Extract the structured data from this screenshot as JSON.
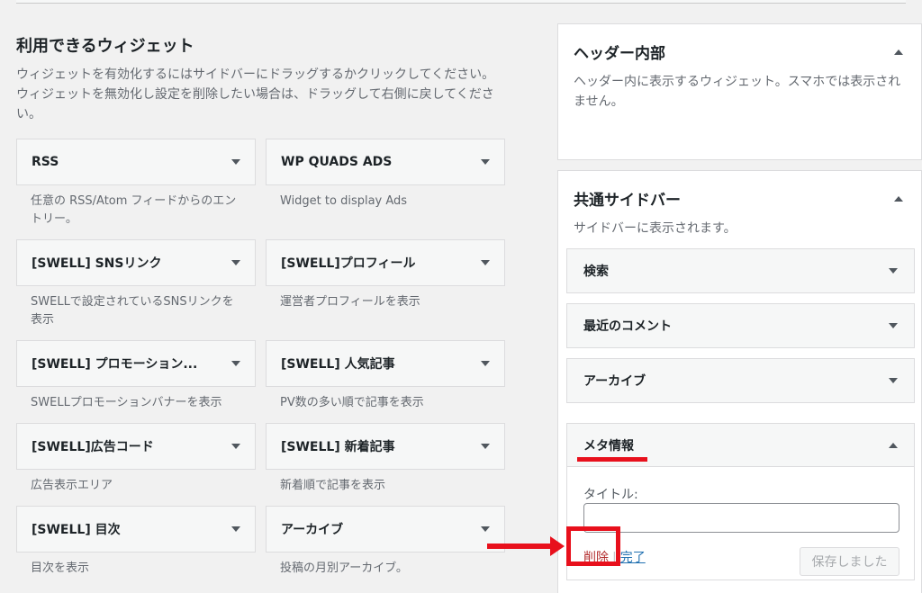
{
  "available": {
    "title": "利用できるウィジェット",
    "description": "ウィジェットを有効化するにはサイドバーにドラッグするかクリックしてください。ウィジェットを無効化し設定を削除したい場合は、ドラッグして右側に戻してください。"
  },
  "widgets": [
    {
      "title": "RSS",
      "desc": "任意の RSS/Atom フィードからのエントリー。"
    },
    {
      "title": "WP QUADS ADS",
      "desc": "Widget to display Ads"
    },
    {
      "title": "[SWELL] SNSリンク",
      "desc": "SWELLで設定されているSNSリンクを表示"
    },
    {
      "title": "[SWELL]プロフィール",
      "desc": "運営者プロフィールを表示"
    },
    {
      "title": "[SWELL] プロモーション...",
      "desc": "SWELLプロモーションバナーを表示"
    },
    {
      "title": "[SWELL] 人気記事",
      "desc": "PV数の多い順で記事を表示"
    },
    {
      "title": "[SWELL]広告コード",
      "desc": "広告表示エリア"
    },
    {
      "title": "[SWELL] 新着記事",
      "desc": "新着順で記事を表示"
    },
    {
      "title": "[SWELL] 目次",
      "desc": "目次を表示"
    },
    {
      "title": "アーカイブ",
      "desc": "投稿の月別アーカイブ。"
    }
  ],
  "header_area": {
    "title": "ヘッダー内部",
    "description": "ヘッダー内に表示するウィジェット。スマホでは表示されません。"
  },
  "sidebar_area": {
    "title": "共通サイドバー",
    "description": "サイドバーに表示されます。",
    "widgets": [
      "検索",
      "最近のコメント",
      "アーカイブ"
    ],
    "open_widget": {
      "title": "メタ情報",
      "field_label": "タイトル:",
      "field_value": "",
      "delete_label": "削除",
      "separator": "|",
      "done_label": "完了",
      "save_label": "保存しました"
    }
  },
  "colors": {
    "highlight": "#e8101c",
    "link": "#2271b1",
    "delete": "#b32d2e"
  }
}
